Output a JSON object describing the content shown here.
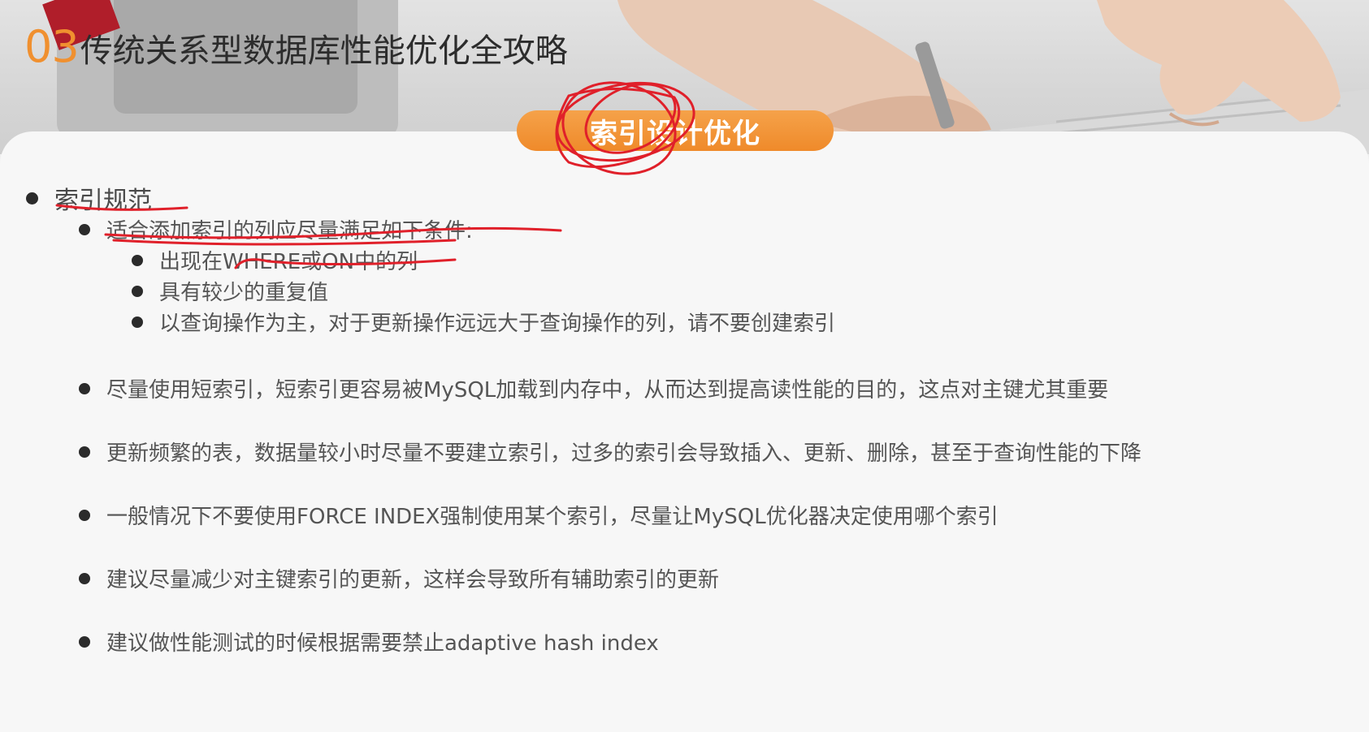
{
  "header": {
    "section_number": "03",
    "title": "传统关系型数据库性能优化全攻略"
  },
  "topic_pill": "索引设计优化",
  "colors": {
    "accent": "#ef8a2a",
    "annotation": "#e0202a"
  },
  "content": {
    "heading": "索引规范",
    "items": [
      {
        "text": "适合添加索引的列应尽量满足如下条件:",
        "sub_items": [
          "出现在WHERE或ON中的列",
          "具有较少的重复值",
          "以查询操作为主，对于更新操作远远大于查询操作的列，请不要创建索引"
        ]
      },
      {
        "text": "尽量使用短索引，短索引更容易被MySQL加载到内存中，从而达到提高读性能的目的，这点对主键尤其重要"
      },
      {
        "text": "更新频繁的表，数据量较小时尽量不要建立索引，过多的索引会导致插入、更新、删除，甚至于查询性能的下降"
      },
      {
        "text": "一般情况下不要使用FORCE INDEX强制使用某个索引，尽量让MySQL优化器决定使用哪个索引"
      },
      {
        "text": "建议尽量减少对主键索引的更新，这样会导致所有辅助索引的更新"
      },
      {
        "text": "建议做性能测试的时候根据需要禁止adaptive hash index"
      }
    ]
  }
}
